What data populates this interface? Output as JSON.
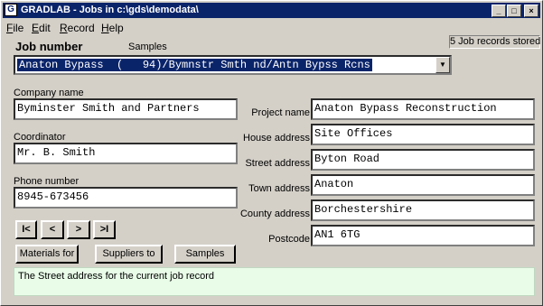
{
  "window": {
    "title": "GRADLAB - Jobs in c:\\gds\\demodata\\",
    "minimize_glyph": "_",
    "maximize_glyph": "□",
    "close_glyph": "×"
  },
  "menu": {
    "items": [
      {
        "u": "F",
        "rest": "ile"
      },
      {
        "u": "E",
        "rest": "dit"
      },
      {
        "u": "R",
        "rest": "ecord"
      },
      {
        "u": "H",
        "rest": "elp"
      }
    ]
  },
  "status": {
    "records_stored": "5 Job records stored"
  },
  "job": {
    "heading": "Job number",
    "samples_label": "Samples",
    "selected": "Anaton Bypass  (   94)/Bymnstr Smth nd/Antn Bypss Rcns",
    "dropdown_glyph": "▼"
  },
  "left": {
    "company_label": "Company name",
    "company_value": "Byminster Smith and Partners",
    "coordinator_label": "Coordinator",
    "coordinator_value": "Mr. B. Smith",
    "phone_label": "Phone number",
    "phone_value": "8945-673456"
  },
  "right": {
    "project_label": "Project name",
    "project_value": "Anaton Bypass Reconstruction",
    "house_label": "House address",
    "house_value": "Site Offices",
    "street_label": "Street address",
    "street_value": "Byton Road",
    "town_label": "Town address",
    "town_value": "Anaton",
    "county_label": "County address",
    "county_value": "Borchestershire",
    "postcode_label": "Postcode",
    "postcode_value": "AN1 6TG"
  },
  "nav": {
    "first": "I<",
    "prev": "<",
    "next": ">",
    "last": ">I"
  },
  "buttons": {
    "materials": "Materials for",
    "suppliers": "Suppliers to",
    "samples": "Samples"
  },
  "help_text": "The Street address for the current job record"
}
